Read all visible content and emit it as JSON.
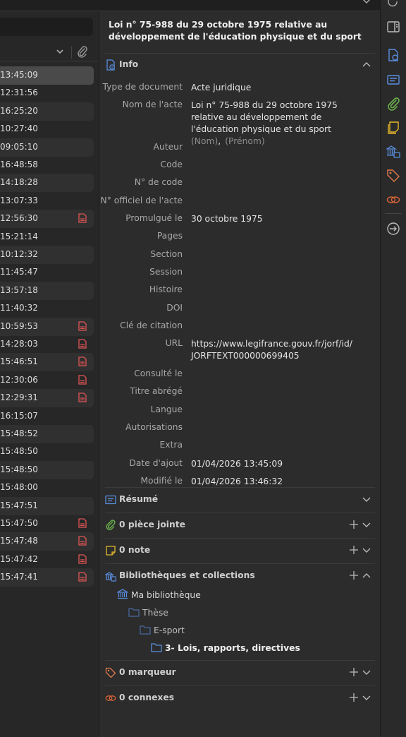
{
  "items_list": {
    "times": [
      "13:45:09",
      "12:31:56",
      "16:25:20",
      "10:27:40",
      "09:05:10",
      "16:48:58",
      "14:18:28",
      "13:07:33",
      "12:56:30",
      "15:21:14",
      "10:12:32",
      "11:45:47",
      "13:57:18",
      "11:40:32",
      "10:59:53",
      "14:28:03",
      "15:46:51",
      "12:30:06",
      "12:29:31",
      "16:15:07",
      "15:48:52",
      "15:48:50",
      "15:48:50",
      "15:48:00",
      "15:47:51",
      "15:47:50",
      "15:47:48",
      "15:47:42",
      "15:47:41"
    ],
    "pdf_rows": [
      8,
      14,
      15,
      16,
      17,
      18,
      25,
      26,
      27,
      28
    ]
  },
  "item_pane": {
    "title": "Loi n° 75-988 du 29 octobre 1975 relative au développement de l'éducation physique et du sport",
    "info": {
      "header": "Info",
      "fields": [
        {
          "label": "Type de document",
          "value": "Acte juridique"
        },
        {
          "label": "Nom de l'acte",
          "value": "Loi n° 75-988 du 29 octobre 1975\nrelative au développement de\nl'éducation physique et du sport"
        },
        {
          "label": "Auteur",
          "value": ""
        },
        {
          "label": "Code",
          "value": ""
        },
        {
          "label": "N° de code",
          "value": ""
        },
        {
          "label": "N° officiel de l'acte",
          "value": ""
        },
        {
          "label": "Promulgué le",
          "value": "30 octobre 1975"
        },
        {
          "label": "Pages",
          "value": ""
        },
        {
          "label": "Section",
          "value": ""
        },
        {
          "label": "Session",
          "value": ""
        },
        {
          "label": "Histoire",
          "value": ""
        },
        {
          "label": "DOI",
          "value": ""
        },
        {
          "label": "Clé de citation",
          "value": ""
        },
        {
          "label": "URL",
          "value": "https://www.legifrance.gouv.fr/jorf/id/\nJORFTEXT000000699405"
        },
        {
          "label": "Consulté le",
          "value": ""
        },
        {
          "label": "Titre abrégé",
          "value": ""
        },
        {
          "label": "Langue",
          "value": ""
        },
        {
          "label": "Autorisations",
          "value": ""
        },
        {
          "label": "Extra",
          "value": ""
        },
        {
          "label": "Date d'ajout",
          "value": "01/04/2026 13:45:09"
        },
        {
          "label": "Modifié le",
          "value": "01/04/2026 13:46:32"
        }
      ],
      "author_last_placeholder": "(Nom)",
      "author_sep": ",",
      "author_first_placeholder": "(Prénom)"
    },
    "sections": {
      "abstract": "Résumé",
      "attachments": "0 pièce jointe",
      "notes": "0 note",
      "libraries": "Bibliothèques et collections",
      "tags": "0 marqueur",
      "related": "0 connexes"
    },
    "tree": {
      "library": "Ma bibliothèque",
      "c1": "Thèse",
      "c2": "E-sport",
      "c3": "3- Lois, rapports, directives"
    }
  },
  "colors": {
    "accent": "#5a8fe0",
    "attachment": "#6ab04c",
    "note": "#e3b72d",
    "tag": "#e07a4a",
    "related": "#d9643a",
    "pdf": "#e05555"
  }
}
